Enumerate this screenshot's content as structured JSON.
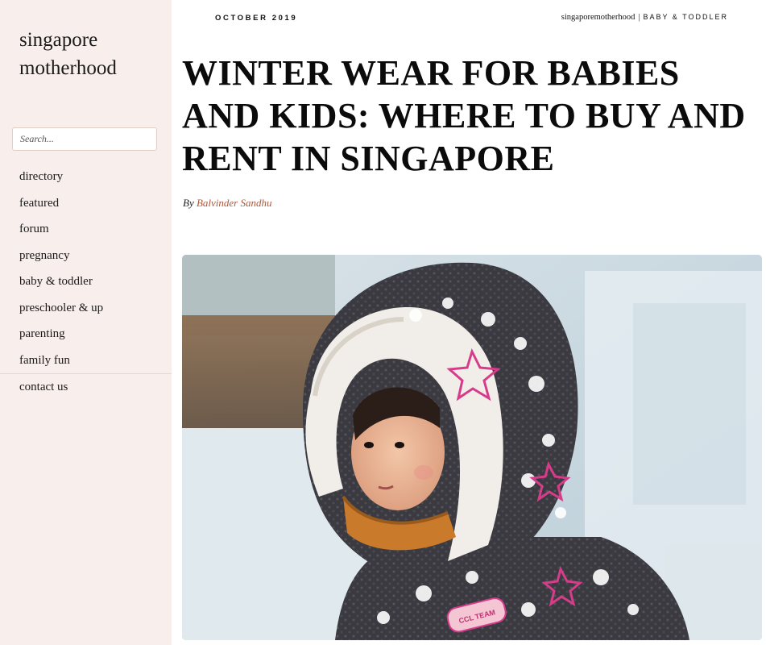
{
  "site": {
    "title": "singapore motherhood"
  },
  "search": {
    "placeholder": "Search..."
  },
  "nav": {
    "items": [
      {
        "label": "directory"
      },
      {
        "label": "featured"
      },
      {
        "label": "forum"
      },
      {
        "label": "pregnancy"
      },
      {
        "label": "baby & toddler"
      },
      {
        "label": "preschooler & up"
      },
      {
        "label": "parenting"
      },
      {
        "label": "family fun"
      },
      {
        "label": "contact us"
      }
    ]
  },
  "article": {
    "date": "OCTOBER 2019",
    "site_link": "singaporemotherhood",
    "separator": "|",
    "category": "BABY & TODDLER",
    "title": "WINTER WEAR FOR BABIES AND KIDS: WHERE TO BUY AND RENT IN SINGAPORE",
    "byline_prefix": "By",
    "author": "Balvinder Sandhu",
    "image_badge": "CCL TEAM"
  },
  "icons": [
    "search-icon"
  ],
  "colors": {
    "sidebar_bg": "#f8eeeb",
    "author_link": "#a9583c",
    "search_border": "#e2cfc4"
  }
}
